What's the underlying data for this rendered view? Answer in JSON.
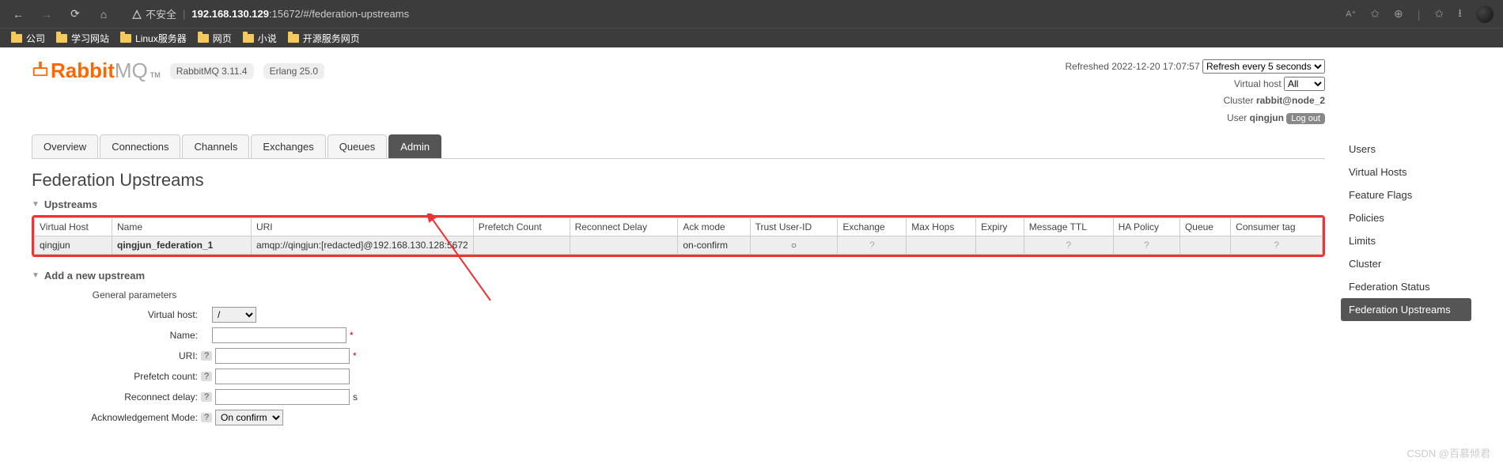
{
  "chrome": {
    "warn_text": "不安全",
    "url_host": "192.168.130.129",
    "url_port_path": ":15672/#/federation-upstreams"
  },
  "bookmarks": [
    "公司",
    "学习网站",
    "Linux服务器",
    "网页",
    "小说",
    "开源服务网页"
  ],
  "logo": {
    "text1": "Rabbit",
    "text2": "MQ",
    "tm": "TM"
  },
  "badges": {
    "version": "RabbitMQ 3.11.4",
    "erlang": "Erlang 25.0"
  },
  "status": {
    "refreshed_label": "Refreshed",
    "refreshed_time": "2022-12-20 17:07:57",
    "refresh_select": "Refresh every 5 seconds",
    "vhost_label": "Virtual host",
    "vhost_value": "All",
    "cluster_label": "Cluster",
    "cluster_value": "rabbit@node_2",
    "user_label": "User",
    "user_value": "qingjun",
    "logout": "Log out"
  },
  "tabs": [
    "Overview",
    "Connections",
    "Channels",
    "Exchanges",
    "Queues",
    "Admin"
  ],
  "active_tab": "Admin",
  "page_title": "Federation Upstreams",
  "section_upstreams": "Upstreams",
  "section_add": "Add a new upstream",
  "table": {
    "headers": [
      "Virtual Host",
      "Name",
      "URI",
      "Prefetch Count",
      "Reconnect Delay",
      "Ack mode",
      "Trust User-ID",
      "Exchange",
      "Max Hops",
      "Expiry",
      "Message TTL",
      "HA Policy",
      "Queue",
      "Consumer tag"
    ],
    "row": {
      "vhost": "qingjun",
      "name": "qingjun_federation_1",
      "uri": "amqp://qingjun:[redacted]@192.168.130.128:5672",
      "prefetch": "",
      "reconnect": "",
      "ack": "on-confirm",
      "trust": "○",
      "exchange": "?",
      "maxhops": "",
      "expiry": "",
      "ttl": "?",
      "ha": "?",
      "queue": "",
      "consumer": "?"
    }
  },
  "form": {
    "general": "General parameters",
    "labels": {
      "vhost": "Virtual host:",
      "name": "Name:",
      "uri": "URI:",
      "prefetch": "Prefetch count:",
      "reconnect": "Reconnect delay:",
      "ack": "Acknowledgement Mode:"
    },
    "vhost_value": "/",
    "ack_value": "On confirm",
    "seconds": "s"
  },
  "sidebar": [
    "Users",
    "Virtual Hosts",
    "Feature Flags",
    "Policies",
    "Limits",
    "Cluster",
    "Federation Status",
    "Federation Upstreams"
  ],
  "sidebar_active": "Federation Upstreams",
  "watermark": "CSDN @百慕倾君"
}
